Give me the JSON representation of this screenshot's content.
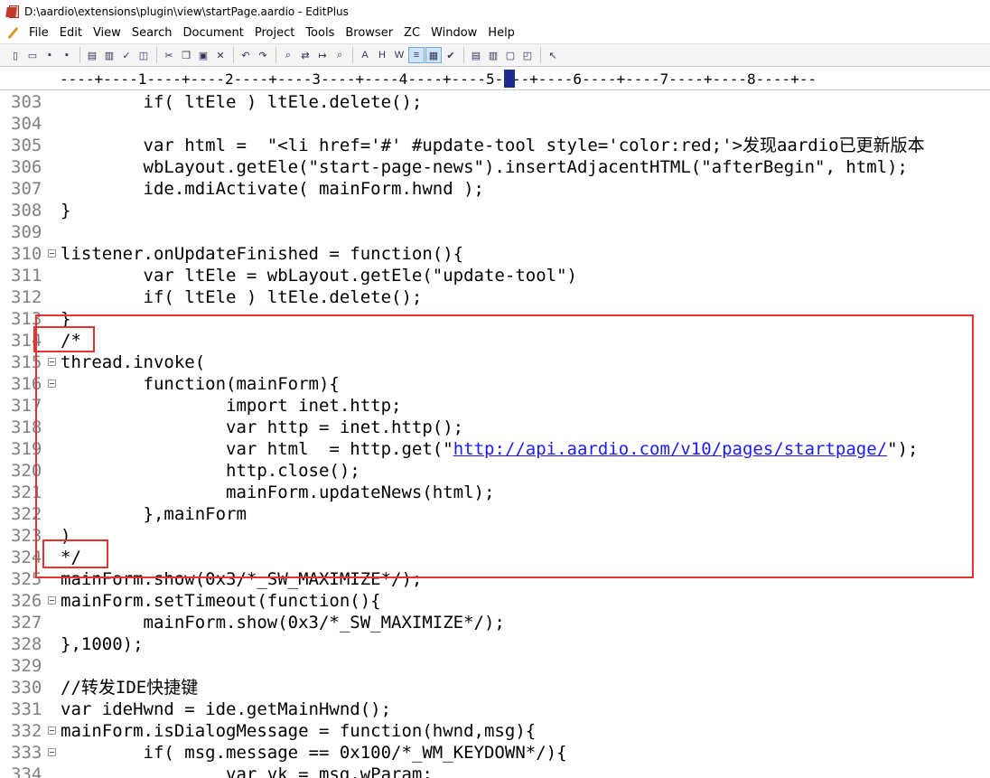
{
  "window": {
    "title": "D:\\aardio\\extensions\\plugin\\view\\startPage.aardio - EditPlus"
  },
  "menu": [
    "File",
    "Edit",
    "View",
    "Search",
    "Document",
    "Project",
    "Tools",
    "Browser",
    "ZC",
    "Window",
    "Help"
  ],
  "toolbar": {
    "icons": [
      "new-file-icon",
      "open-icon",
      "save-icon",
      "save-all-icon",
      "print-preview-icon",
      "print-icon",
      "spellcheck-icon",
      "browser-preview-icon",
      "cut-icon",
      "copy-icon",
      "paste-icon",
      "delete-icon",
      "undo-icon",
      "redo-icon",
      "find-icon",
      "replace-icon",
      "goto-icon",
      "find-in-files-icon",
      "font-icon",
      "hex-icon",
      "word-wrap-icon",
      "line-wrap-icon",
      "ruler-icon",
      "check-icon",
      "window-tile-icon",
      "window-list-icon",
      "full-screen-icon",
      "fit-window-icon",
      "help-cursor-icon"
    ],
    "active": [
      "line-wrap-icon",
      "ruler-icon"
    ]
  },
  "ruler": {
    "text": "----+----1----+----2----+----3----+----4----+----5----+----6----+----7----+----8----+--"
  },
  "editor": {
    "link_text": "http://api.aardio.com/v10/pages/startpage/",
    "lines": [
      {
        "n": "303",
        "text": "        if( ltEle ) ltEle.delete();"
      },
      {
        "n": "304",
        "text": ""
      },
      {
        "n": "305",
        "text": "        var html =  \"<li href='#' #update-tool style='color:red;'>发现aardio已更新版本"
      },
      {
        "n": "306",
        "text": "        wbLayout.getEle(\"start-page-news\").insertAdjacentHTML(\"afterBegin\", html);"
      },
      {
        "n": "307",
        "text": "        ide.mdiActivate( mainForm.hwnd );"
      },
      {
        "n": "308",
        "text": "}"
      },
      {
        "n": "309",
        "text": ""
      },
      {
        "n": "310",
        "text": "listener.onUpdateFinished = function(){",
        "fold": true
      },
      {
        "n": "311",
        "text": "        var ltEle = wbLayout.getEle(\"update-tool\")"
      },
      {
        "n": "312",
        "text": "        if( ltEle ) ltEle.delete();"
      },
      {
        "n": "313",
        "text": "}"
      },
      {
        "n": "314",
        "text": "/*"
      },
      {
        "n": "315",
        "text": "thread.invoke(",
        "fold": true
      },
      {
        "n": "316",
        "text": "        function(mainForm){",
        "fold": true
      },
      {
        "n": "317",
        "text": "                import inet.http;"
      },
      {
        "n": "318",
        "text": "                var http = inet.http();"
      },
      {
        "n": "319",
        "pre": "                var html  = http.get(\"",
        "post": "\");",
        "has_link": true
      },
      {
        "n": "320",
        "text": "                http.close();"
      },
      {
        "n": "321",
        "text": "                mainForm.updateNews(html);"
      },
      {
        "n": "322",
        "text": "        },mainForm"
      },
      {
        "n": "323",
        "text": ")"
      },
      {
        "n": "324",
        "text": "*/"
      },
      {
        "n": "325",
        "text": "mainForm.show(0x3/*_SW_MAXIMIZE*/);"
      },
      {
        "n": "326",
        "text": "mainForm.setTimeout(function(){",
        "fold": true
      },
      {
        "n": "327",
        "text": "        mainForm.show(0x3/*_SW_MAXIMIZE*/);"
      },
      {
        "n": "328",
        "text": "},1000);"
      },
      {
        "n": "329",
        "text": ""
      },
      {
        "n": "330",
        "text": "//转发IDE快捷键"
      },
      {
        "n": "331",
        "text": "var ideHwnd = ide.getMainHwnd();"
      },
      {
        "n": "332",
        "text": "mainForm.isDialogMessage = function(hwnd,msg){",
        "fold": true
      },
      {
        "n": "333",
        "text": "        if( msg.message == 0x100/*_WM_KEYDOWN*/){",
        "fold": true
      },
      {
        "n": "334",
        "text": "                var vk = msg.wParam;"
      }
    ]
  },
  "colors": {
    "annotation": "#e8322f",
    "line_number": "#808080",
    "link": "#1a1aff",
    "ruler_cursor": "#1f2a8a"
  }
}
